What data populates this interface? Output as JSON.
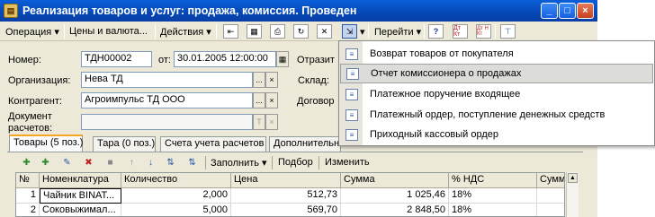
{
  "window": {
    "title": "Реализация товаров и услуг: продажа, комиссия. Проведен",
    "controls": [
      "_",
      "□",
      "×"
    ]
  },
  "toolbar": {
    "operation": "Операция ▾",
    "prices": "Цены и валюта...",
    "actions": "Действия ▾",
    "goto": "Перейти ▾",
    "help": "?",
    "dt_kt": "Дт Кт",
    "dt_kt2": "Дт Н Кт"
  },
  "form": {
    "number_label": "Номер:",
    "number_value": "ТДН00002",
    "from_label": "от:",
    "date_value": "30.01.2005 12:00:00",
    "reflect_label": "Отразит",
    "org_label": "Организация:",
    "org_value": "Нева ТД",
    "warehouse_label": "Склад:",
    "contractor_label": "Контрагент:",
    "contractor_value": "Агроимпульс ТД ООО",
    "contract_label": "Договор",
    "doc_label": "Документ",
    "doc_label2": "расчетов:",
    "ellipsis": "...",
    "clear": "×",
    "t_btn": "T"
  },
  "tabs": [
    {
      "label": "Товары (5 поз.)"
    },
    {
      "label": "Тара (0 поз.)"
    },
    {
      "label": "Счета учета расчетов"
    },
    {
      "label": "Дополнительно"
    }
  ],
  "table_toolbar": {
    "fill": "Заполнить ▾",
    "select": "Подбор",
    "change": "Изменить"
  },
  "grid": {
    "headers": [
      "№",
      "Номенклатура",
      "Количество",
      "Цена",
      "Сумма",
      "% НДС",
      "Сумма"
    ],
    "rows": [
      [
        "1",
        "Чайник BINAT...",
        "2,000",
        "512,73",
        "1 025,46",
        "18%",
        ""
      ],
      [
        "2",
        "Соковыжимал...",
        "5,000",
        "569,70",
        "2 848,50",
        "18%",
        ""
      ]
    ]
  },
  "menu": {
    "items": [
      {
        "label": "Возврат товаров от покупателя"
      },
      {
        "label": "Отчет комиссионера о продажах"
      },
      {
        "label": "Платежное поручение входящее"
      },
      {
        "label": "Платежный ордер, поступление денежных средств"
      },
      {
        "label": "Приходный кассовый ордер"
      }
    ],
    "highlighted_index": 1
  }
}
